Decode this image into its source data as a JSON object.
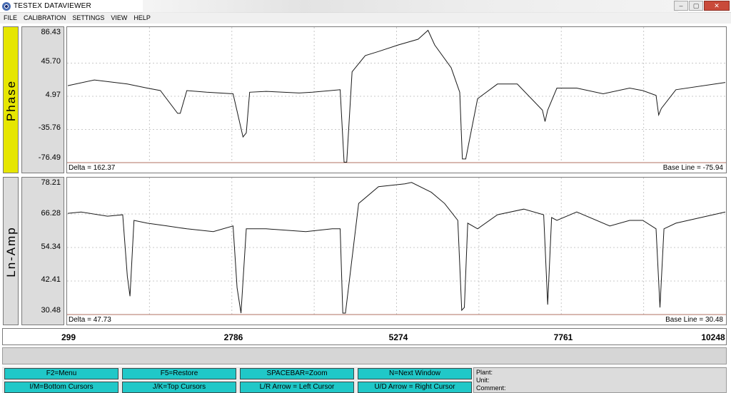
{
  "window": {
    "title": "TESTEX DATAVIEWER"
  },
  "menu": [
    "FILE",
    "CALIBRATION",
    "SETTINGS",
    "VIEW",
    "HELP"
  ],
  "colors": {
    "phase_label_bg": "#e6e600",
    "amp_label_bg": "#dcdcdc",
    "key_button": "#20c8c8"
  },
  "phase": {
    "label": "Phase",
    "ticks": [
      "86.43",
      "45.70",
      "4.97",
      "-35.76",
      "-76.49"
    ],
    "delta": "Delta = 162.37",
    "baseline": "Base Line = -75.94"
  },
  "amp": {
    "label": "Ln-Amp",
    "ticks": [
      "78.21",
      "66.28",
      "54.34",
      "42.41",
      "30.48"
    ],
    "delta": "Delta = 47.73",
    "baseline": "Base Line = 30.48"
  },
  "xaxis": {
    "ticks": [
      "299",
      "2786",
      "5274",
      "7761",
      "10248"
    ]
  },
  "keys": [
    "F2=Menu",
    "F5=Restore",
    "SPACEBAR=Zoom",
    "N=Next Window",
    "I/M=Bottom Cursors",
    "J/K=Top Cursors",
    "L/R Arrow = Left Cursor",
    "U/D Arrow = Right Cursor"
  ],
  "info": {
    "plant": "Plant:",
    "unit": "Unit:",
    "comment": "Comment:"
  },
  "chart_data": [
    {
      "type": "line",
      "ylabel": "Phase",
      "ylim": [
        -76.49,
        86.43
      ],
      "xlim": [
        299,
        10248
      ],
      "series": [
        {
          "x": [
            299,
            700,
            1200,
            1500,
            1700,
            1960,
            2000,
            2100,
            2400,
            2800,
            2950,
            3000,
            3050,
            3300,
            3800,
            4000,
            4420,
            4480,
            4520,
            4600,
            4800,
            5000,
            5300,
            5600,
            5750,
            5850,
            6100,
            6230,
            6270,
            6320,
            6500,
            6800,
            7100,
            7480,
            7520,
            7560,
            7700,
            8000,
            8400,
            8800,
            9000,
            9200,
            9240,
            9280,
            9500,
            10248
          ],
          "values": [
            18,
            25,
            20,
            15,
            12,
            -16,
            -16,
            12,
            10,
            8,
            -45,
            -40,
            10,
            11,
            9,
            10,
            13,
            -76,
            -76,
            35,
            55,
            60,
            68,
            75,
            86,
            68,
            40,
            10,
            -72,
            -72,
            2,
            20,
            20,
            -12,
            -26,
            -12,
            15,
            15,
            8,
            15,
            12,
            6,
            -18,
            -10,
            13,
            22
          ]
        }
      ]
    },
    {
      "type": "line",
      "ylabel": "Ln-Amp",
      "ylim": [
        30.48,
        78.21
      ],
      "xlim": [
        299,
        10248
      ],
      "series": [
        {
          "x": [
            299,
            500,
            900,
            1130,
            1200,
            1240,
            1300,
            1500,
            1800,
            2100,
            2500,
            2800,
            2860,
            2920,
            3000,
            3300,
            3900,
            4300,
            4420,
            4460,
            4500,
            4700,
            5000,
            5400,
            5500,
            5800,
            6000,
            6200,
            6260,
            6300,
            6350,
            6500,
            6800,
            7200,
            7500,
            7560,
            7620,
            7700,
            8000,
            8500,
            8800,
            9000,
            9200,
            9260,
            9320,
            9500,
            10248
          ],
          "values": [
            66.5,
            67,
            65.5,
            66,
            44,
            37,
            64,
            63,
            62,
            61,
            60,
            62,
            40,
            31,
            61,
            61,
            60,
            61,
            61,
            31,
            31,
            70,
            76,
            77,
            77.5,
            74,
            70,
            64,
            32,
            33,
            63,
            61,
            66,
            68,
            66,
            34,
            65,
            64,
            67,
            62,
            64,
            64,
            61,
            33,
            61,
            63,
            67
          ]
        }
      ]
    }
  ]
}
